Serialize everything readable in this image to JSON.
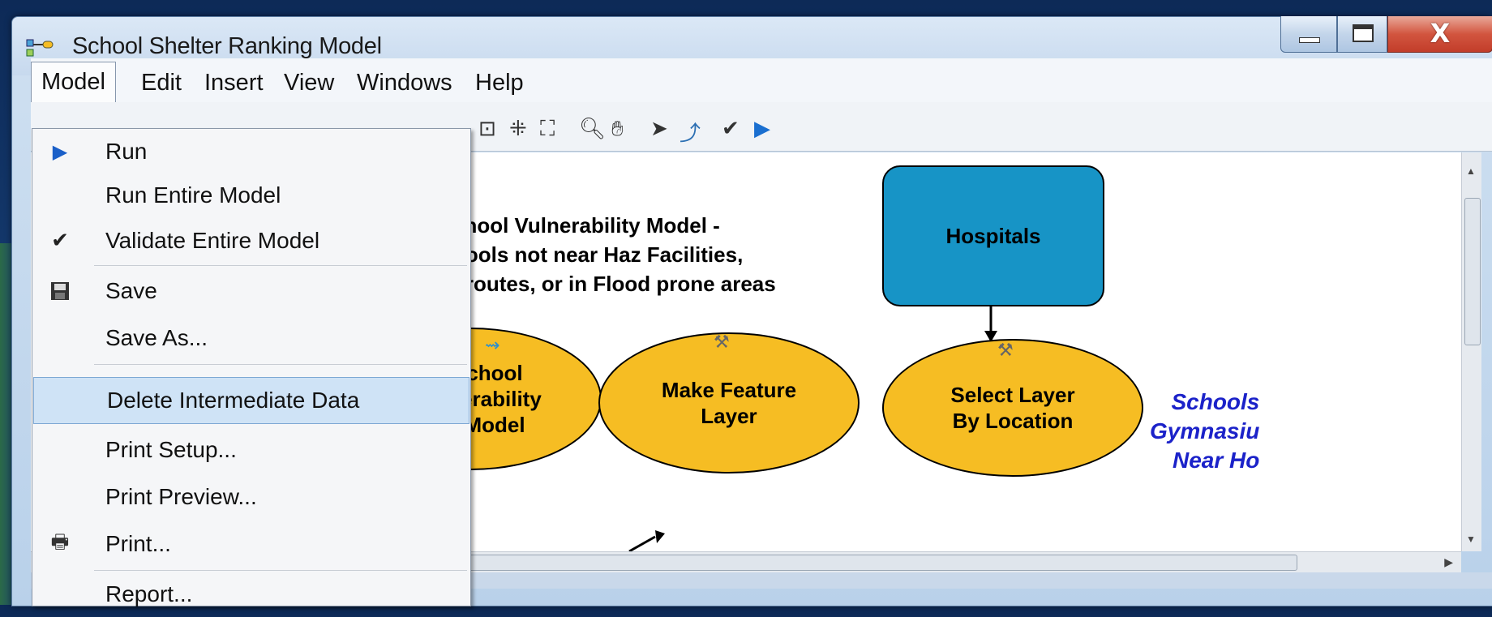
{
  "window": {
    "title": "School Shelter Ranking Model"
  },
  "menubar": {
    "items": [
      "Model",
      "Edit",
      "Insert",
      "View",
      "Windows",
      "Help"
    ]
  },
  "model_menu": {
    "items": [
      {
        "label": "Run",
        "icon": "run-icon"
      },
      {
        "label": "Run Entire Model",
        "icon": ""
      },
      {
        "label": "Validate Entire Model",
        "icon": "check-icon"
      },
      {
        "label": "Save",
        "icon": "save-icon"
      },
      {
        "label": "Save As...",
        "icon": ""
      },
      {
        "label": "Delete Intermediate Data",
        "icon": "",
        "highlighted": true
      },
      {
        "label": "Print Setup...",
        "icon": ""
      },
      {
        "label": "Print Preview...",
        "icon": ""
      },
      {
        "label": "Print...",
        "icon": "printer-icon"
      },
      {
        "label": "Report...",
        "icon": ""
      }
    ]
  },
  "toolbar": {
    "icons": [
      "full-extent-icon",
      "fixed-zoom-in-icon",
      "fixed-zoom-out-icon",
      "zoom-icon",
      "pan-icon",
      "select-icon",
      "connect-icon",
      "validate-icon",
      "run-icon"
    ]
  },
  "diagram": {
    "note": "chool Vulnerability Model -\nhools not near Haz Facilities,\nt routes, or in Flood prone areas",
    "hospitals": "Hospitals",
    "school_model": "chool\nnerability\nModel",
    "make_feature_layer": "Make Feature\nLayer",
    "select_layer": "Select Layer\nBy Location",
    "blue_label": "Schools\nGymnasiu\nNear Ho"
  },
  "colors": {
    "process_fill": "#f6bd23",
    "data_fill": "#1794c6",
    "label_blue": "#1b22c9"
  }
}
